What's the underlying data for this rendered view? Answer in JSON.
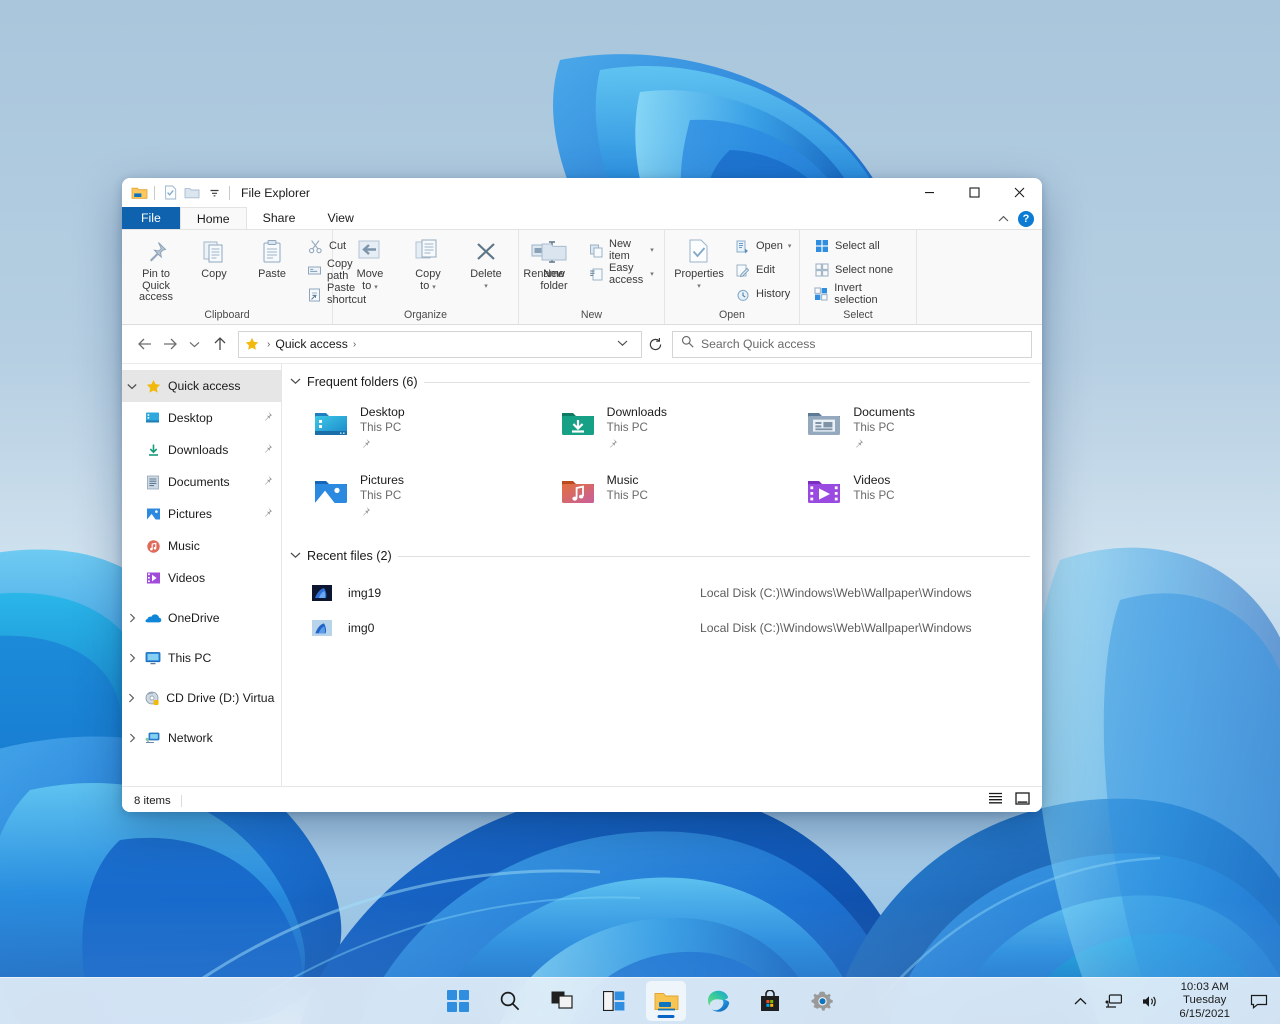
{
  "desktop": {
    "wallpaper_name": "windows-11-bloom-wallpaper"
  },
  "window": {
    "title": "File Explorer",
    "quick_access_toolbar": [
      {
        "name": "folder-icon",
        "label": "File Explorer"
      },
      {
        "name": "properties-icon",
        "label": "Properties"
      },
      {
        "name": "new-folder-icon",
        "label": "New folder"
      },
      {
        "name": "customize-qat-caret-icon",
        "label": "Customize Quick Access Toolbar"
      }
    ],
    "controls": {
      "minimize": "—",
      "maximize": "□",
      "close": "✕",
      "collapse_ribbon": "^",
      "help": "?"
    }
  },
  "ribbon": {
    "tabs": [
      {
        "label": "File",
        "state": "file"
      },
      {
        "label": "Home",
        "state": "active"
      },
      {
        "label": "Share",
        "state": "normal"
      },
      {
        "label": "View",
        "state": "normal"
      }
    ],
    "groups": [
      {
        "name": "Clipboard",
        "big_buttons": [
          {
            "label": "Pin to Quick\naccess",
            "line1": "Pin to Quick",
            "line2": "access",
            "icon": "pin-icon"
          },
          {
            "label": "Copy",
            "line1": "Copy",
            "line2": "",
            "icon": "copy-icon"
          },
          {
            "label": "Paste",
            "line1": "Paste",
            "line2": "",
            "icon": "paste-icon"
          }
        ],
        "small_buttons": [
          {
            "label": "Cut",
            "icon": "scissors-icon"
          },
          {
            "label": "Copy path",
            "icon": "copy-path-icon"
          },
          {
            "label": "Paste shortcut",
            "icon": "paste-shortcut-icon"
          }
        ]
      },
      {
        "name": "Organize",
        "big_buttons": [
          {
            "label": "Move to",
            "line1": "Move",
            "line2": "to",
            "icon": "move-to-icon",
            "has_caret": true
          },
          {
            "label": "Copy to",
            "line1": "Copy",
            "line2": "to",
            "icon": "copy-to-icon",
            "has_caret": true
          },
          {
            "label": "Delete",
            "line1": "Delete",
            "line2": "",
            "icon": "delete-icon",
            "has_caret": true
          },
          {
            "label": "Rename",
            "line1": "Rename",
            "line2": "",
            "icon": "rename-icon"
          }
        ],
        "small_buttons": []
      },
      {
        "name": "New",
        "big_buttons": [
          {
            "label": "New folder",
            "line1": "New",
            "line2": "folder",
            "icon": "new-folder-icon"
          }
        ],
        "small_buttons": [
          {
            "label": "New item",
            "icon": "new-item-icon",
            "has_caret": true
          },
          {
            "label": "Easy access",
            "icon": "easy-access-icon",
            "has_caret": true
          }
        ]
      },
      {
        "name": "Open",
        "big_buttons": [
          {
            "label": "Properties",
            "line1": "Properties",
            "line2": "",
            "icon": "properties-icon",
            "has_caret": true
          }
        ],
        "small_buttons": [
          {
            "label": "Open",
            "icon": "open-icon",
            "has_caret": true
          },
          {
            "label": "Edit",
            "icon": "edit-icon"
          },
          {
            "label": "History",
            "icon": "history-icon"
          }
        ]
      },
      {
        "name": "Select",
        "big_buttons": [],
        "small_buttons": [
          {
            "label": "Select all",
            "icon": "select-all-icon"
          },
          {
            "label": "Select none",
            "icon": "select-none-icon"
          },
          {
            "label": "Invert selection",
            "icon": "invert-selection-icon"
          }
        ]
      }
    ]
  },
  "addressbar": {
    "back_icon": "back-arrow-icon",
    "forward_icon": "forward-arrow-icon",
    "recent_icon": "recent-locations-chevron-icon",
    "up_icon": "up-arrow-icon",
    "breadcrumb_icon": "quick-access-star-icon",
    "breadcrumb": "Quick access",
    "breadcrumb_separator": "›",
    "dropdown_icon": "chevron-down-icon",
    "refresh_icon": "refresh-icon",
    "search_icon": "search-icon",
    "search_placeholder": "Search Quick access",
    "search_value": ""
  },
  "sidebar": {
    "items": [
      {
        "label": "Quick access",
        "icon": "star-icon",
        "expander": "chevron-down",
        "selected": true,
        "child": false,
        "pinned": false
      },
      {
        "label": "Desktop",
        "icon": "desktop-folder-icon",
        "expander": "",
        "selected": false,
        "child": true,
        "pinned": true
      },
      {
        "label": "Downloads",
        "icon": "downloads-icon",
        "expander": "",
        "selected": false,
        "child": true,
        "pinned": true
      },
      {
        "label": "Documents",
        "icon": "documents-icon",
        "expander": "",
        "selected": false,
        "child": true,
        "pinned": true
      },
      {
        "label": "Pictures",
        "icon": "pictures-icon",
        "expander": "",
        "selected": false,
        "child": true,
        "pinned": true
      },
      {
        "label": "Music",
        "icon": "music-icon",
        "expander": "",
        "selected": false,
        "child": true,
        "pinned": false
      },
      {
        "label": "Videos",
        "icon": "videos-icon",
        "expander": "",
        "selected": false,
        "child": true,
        "pinned": false
      },
      {
        "label": "OneDrive",
        "icon": "onedrive-cloud-icon",
        "expander": "chevron-right",
        "selected": false,
        "child": false,
        "pinned": false
      },
      {
        "label": "This PC",
        "icon": "this-pc-monitor-icon",
        "expander": "chevron-right",
        "selected": false,
        "child": false,
        "pinned": false
      },
      {
        "label": "CD Drive (D:) Virtuall",
        "icon": "cd-drive-icon",
        "expander": "chevron-right",
        "selected": false,
        "child": false,
        "pinned": false
      },
      {
        "label": "Network",
        "icon": "network-icon",
        "expander": "chevron-right",
        "selected": false,
        "child": false,
        "pinned": false
      }
    ]
  },
  "main": {
    "frequent_folders": {
      "heading": "Frequent folders (6)",
      "items": [
        {
          "name": "Desktop",
          "location": "This PC",
          "icon": "desktop-folder-icon",
          "pinned": true
        },
        {
          "name": "Downloads",
          "location": "This PC",
          "icon": "downloads-folder-icon",
          "pinned": true
        },
        {
          "name": "Documents",
          "location": "This PC",
          "icon": "documents-folder-icon",
          "pinned": true
        },
        {
          "name": "Pictures",
          "location": "This PC",
          "icon": "pictures-folder-icon",
          "pinned": true
        },
        {
          "name": "Music",
          "location": "This PC",
          "icon": "music-folder-icon",
          "pinned": false
        },
        {
          "name": "Videos",
          "location": "This PC",
          "icon": "videos-folder-icon",
          "pinned": false
        }
      ]
    },
    "recent_files": {
      "heading": "Recent files (2)",
      "items": [
        {
          "name": "img19",
          "path": "Local Disk (C:)\\Windows\\Web\\Wallpaper\\Windows",
          "icon": "image-thumbnail-dark"
        },
        {
          "name": "img0",
          "path": "Local Disk (C:)\\Windows\\Web\\Wallpaper\\Windows",
          "icon": "image-thumbnail-light"
        }
      ]
    }
  },
  "statusbar": {
    "item_count": "8 items",
    "views": [
      {
        "name": "details-view-button",
        "icon": "list-lines-icon"
      },
      {
        "name": "large-icons-view-button",
        "icon": "large-icon-square-icon"
      }
    ]
  },
  "taskbar": {
    "icons": [
      {
        "name": "start-button",
        "label": "Start",
        "active": false
      },
      {
        "name": "search-button",
        "label": "Search",
        "active": false
      },
      {
        "name": "task-view-button",
        "label": "Task View",
        "active": false
      },
      {
        "name": "widgets-button",
        "label": "Widgets",
        "active": false
      },
      {
        "name": "file-explorer-button",
        "label": "File Explorer",
        "active": true
      },
      {
        "name": "edge-button",
        "label": "Microsoft Edge",
        "active": false
      },
      {
        "name": "store-button",
        "label": "Microsoft Store",
        "active": false
      },
      {
        "name": "settings-button",
        "label": "Settings",
        "active": false
      }
    ],
    "tray": {
      "overflow_icon": "chevron-up-icon",
      "network_icon": "network-tray-icon",
      "volume_icon": "volume-tray-icon",
      "notifications_icon": "notification-chat-icon"
    },
    "clock": {
      "time": "10:03 AM",
      "day": "Tuesday",
      "date": "6/15/2021"
    }
  },
  "colors": {
    "accent": "#0078d4",
    "file_tab": "#0f62ad",
    "window_bg": "#ffffff",
    "ribbon_bg": "#f9f9f9",
    "taskbar_bg": "#ebf2f9"
  }
}
